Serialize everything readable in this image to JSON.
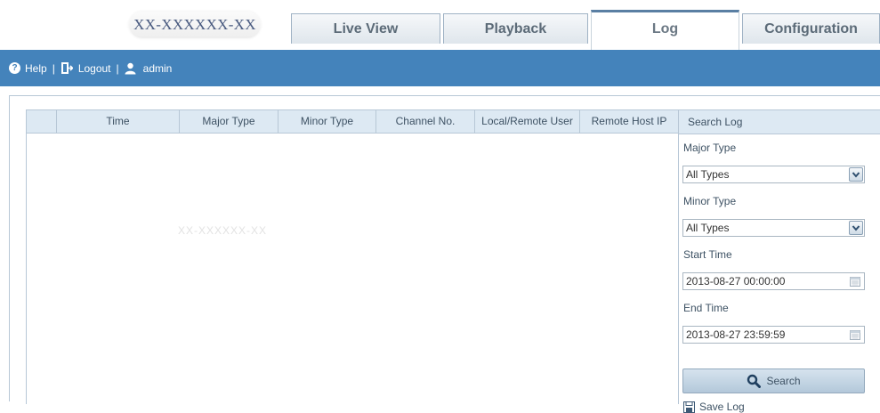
{
  "header": {
    "logo_text": "XX-XXXXXX-XX",
    "tabs": [
      {
        "label": "Live View",
        "active": false
      },
      {
        "label": "Playback",
        "active": false
      },
      {
        "label": "Log",
        "active": true
      },
      {
        "label": "Configuration",
        "active": false
      }
    ]
  },
  "nav": {
    "help_label": "Help",
    "logout_label": "Logout",
    "user_label": "admin",
    "separator": "|"
  },
  "table": {
    "columns": [
      "",
      "Time",
      "Major Type",
      "Minor Type",
      "Channel No.",
      "Local/Remote User",
      "Remote Host IP"
    ],
    "rows": [],
    "watermark": "XX-XXXXXX-XX"
  },
  "search_panel": {
    "title": "Search Log",
    "major_type_label": "Major Type",
    "major_type_value": "All Types",
    "minor_type_label": "Minor Type",
    "minor_type_value": "All Types",
    "start_time_label": "Start Time",
    "start_time_value": "2013-08-27 00:00:00",
    "end_time_label": "End Time",
    "end_time_value": "2013-08-27 23:59:59",
    "search_button": "Search",
    "save_log_label": "Save Log"
  },
  "colors": {
    "nav_bar": "#4483bb",
    "table_header": "#dde9f3",
    "border": "#b7c7d6"
  }
}
